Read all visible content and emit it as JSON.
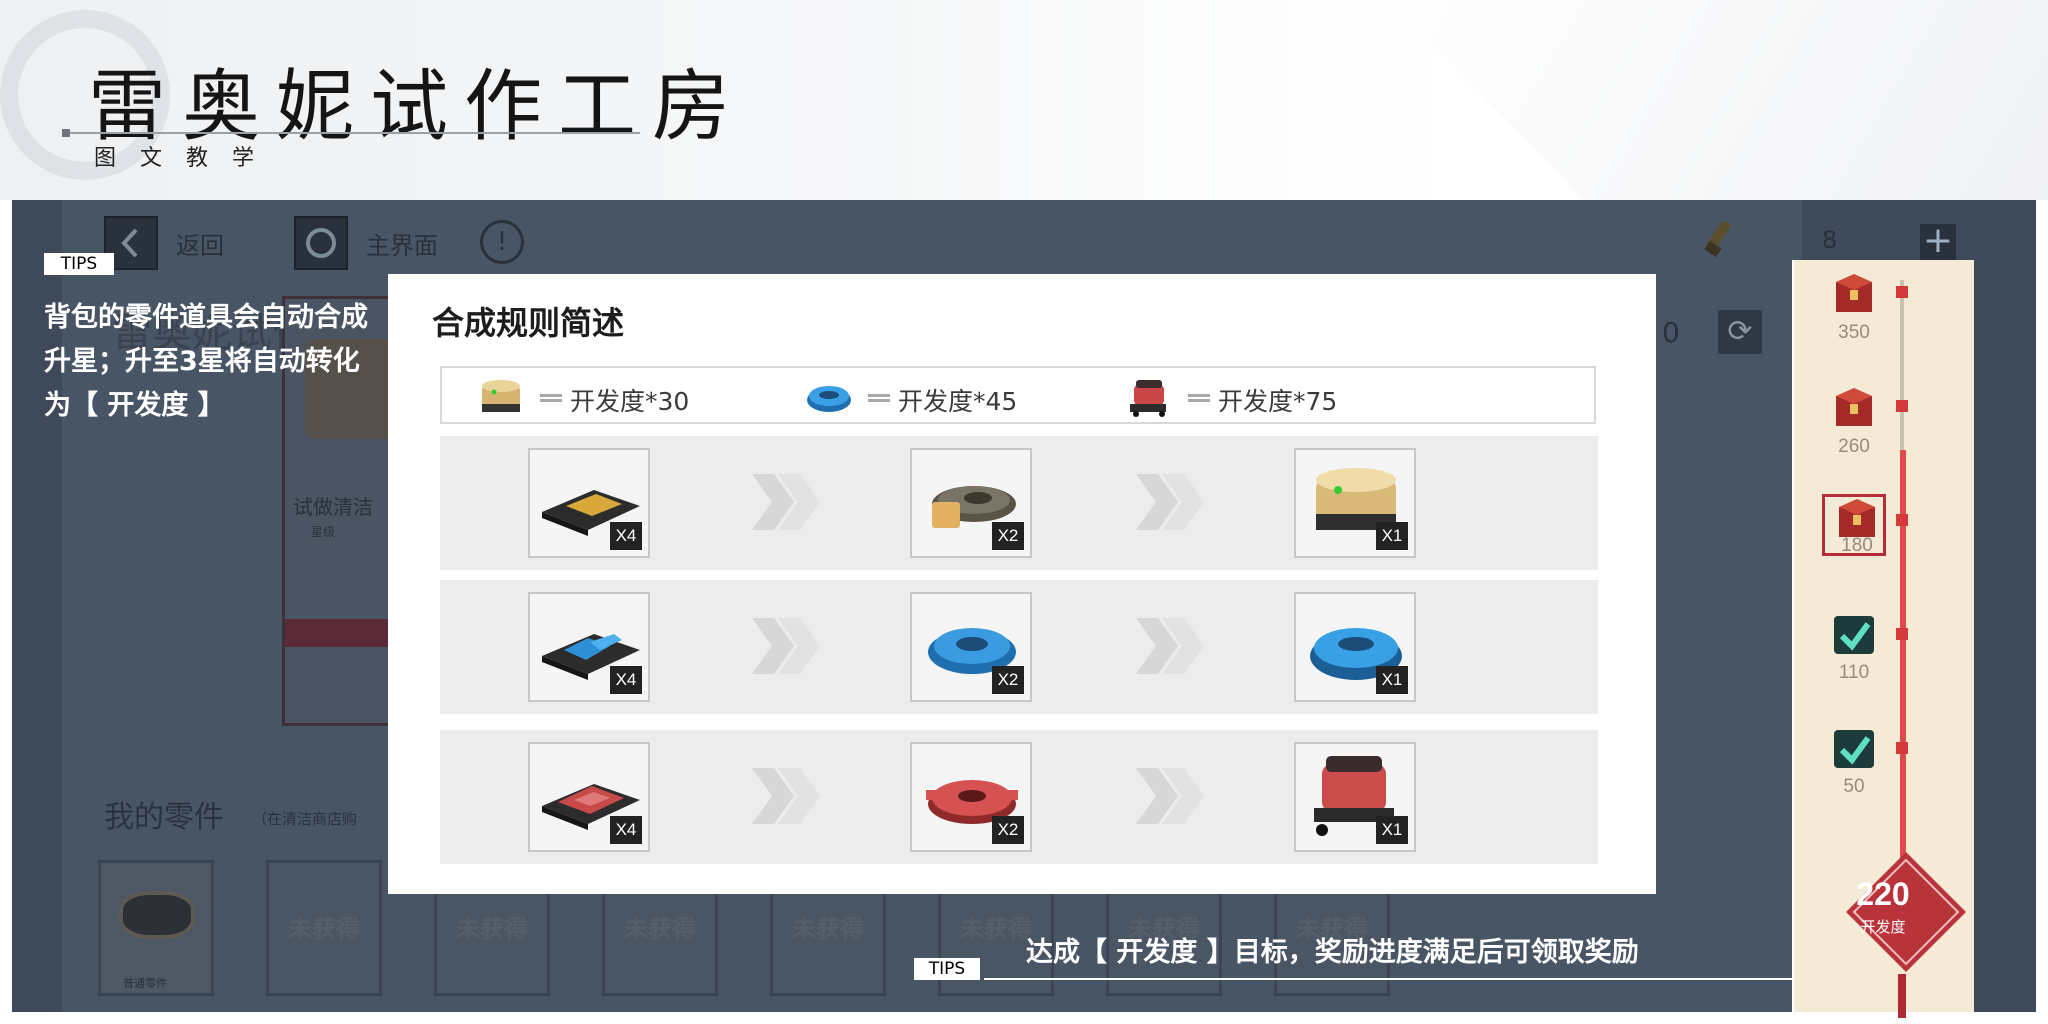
{
  "header": {
    "title": "雷奥妮试作工房",
    "subtitle": "图文教学"
  },
  "game": {
    "back_label": "返回",
    "home_label": "主界面",
    "info_icon": "!",
    "currency_value": "8",
    "plus_icon": "+",
    "refresh_icon": "⟳",
    "partial_number": "0",
    "bg_title": "雷奥妮试作工",
    "bg_card_name": "试做清洁",
    "bg_card_sub": "星级",
    "parts_title": "我的零件",
    "parts_note": "（在清洁商店购",
    "part_first_label": "普通零件",
    "unobtained_label": "未获得"
  },
  "tips_left": {
    "tag": "TIPS",
    "text": "背包的零件道具会自动合成升星；升至3星将自动转化为【 开发度 】"
  },
  "tips_bottom": {
    "tag": "TIPS",
    "text": "达成【 开发度 】目标，奖励进度满足后可领取奖励"
  },
  "modal": {
    "title": "合成规则简述",
    "legend": [
      {
        "icon": "gold-robot-vacuum-icon",
        "text": "开发度*30"
      },
      {
        "icon": "blue-robot-vacuum-icon",
        "text": "开发度*45"
      },
      {
        "icon": "red-floor-scrubber-icon",
        "text": "开发度*75"
      }
    ],
    "rows": [
      {
        "theme": "gold",
        "cells": [
          {
            "icon": "gold-part-plate-icon",
            "qty": "X4"
          },
          {
            "icon": "gold-part-ring-icon",
            "qty": "X2"
          },
          {
            "icon": "gold-robot-vacuum-icon",
            "qty": "X1"
          }
        ]
      },
      {
        "theme": "blue",
        "cells": [
          {
            "icon": "blue-part-plate-icon",
            "qty": "X4"
          },
          {
            "icon": "blue-part-ring-icon",
            "qty": "X2"
          },
          {
            "icon": "blue-robot-vacuum-icon",
            "qty": "X1"
          }
        ]
      },
      {
        "theme": "red",
        "cells": [
          {
            "icon": "red-part-board-icon",
            "qty": "X4"
          },
          {
            "icon": "red-part-gear-icon",
            "qty": "X2"
          },
          {
            "icon": "red-floor-scrubber-icon",
            "qty": "X1"
          }
        ]
      }
    ]
  },
  "progress": {
    "milestones": [
      {
        "value": "350",
        "state": "locked"
      },
      {
        "value": "260",
        "state": "locked"
      },
      {
        "value": "180",
        "state": "current"
      },
      {
        "value": "110",
        "state": "claimed"
      },
      {
        "value": "50",
        "state": "claimed"
      }
    ],
    "goal_value": "220",
    "goal_label": "开发度"
  },
  "colors": {
    "frame_bg": "#3e4a5a",
    "accent_red": "#d4393b",
    "strip_bg": "#f4ead5",
    "gold": "#d8b46a",
    "blue": "#2d8ad0"
  }
}
